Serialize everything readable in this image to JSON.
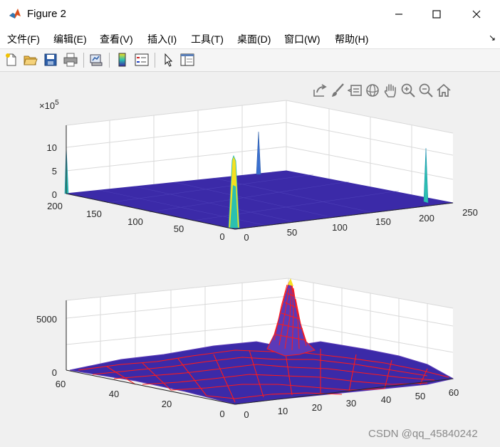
{
  "window": {
    "title": "Figure 2",
    "controls": [
      "minimize",
      "maximize",
      "close"
    ]
  },
  "menu": [
    {
      "label": "文件(F)"
    },
    {
      "label": "编辑(E)"
    },
    {
      "label": "查看(V)"
    },
    {
      "label": "插入(I)"
    },
    {
      "label": "工具(T)"
    },
    {
      "label": "桌面(D)"
    },
    {
      "label": "窗口(W)"
    },
    {
      "label": "帮助(H)"
    }
  ],
  "toolbar": [
    "new-figure-icon",
    "open-file-icon",
    "save-icon",
    "print-icon",
    "link-plot-icon",
    "colorbar-icon",
    "legend-icon",
    "edit-plot-arrow-icon",
    "property-inspector-icon"
  ],
  "axes_toolbar": [
    "export-icon",
    "brush-icon",
    "data-tips-icon",
    "rotate-3d-icon",
    "pan-hand-icon",
    "zoom-in-icon",
    "zoom-out-icon",
    "home-icon"
  ],
  "plot1": {
    "exponent_base": "×10",
    "exponent_power": "5",
    "z_ticks": [
      "0",
      "5",
      "10"
    ],
    "y_ticks": [
      "0",
      "50",
      "100",
      "150",
      "200"
    ],
    "x_ticks": [
      "0",
      "50",
      "100",
      "150",
      "200",
      "250"
    ]
  },
  "plot2": {
    "z_ticks": [
      "0",
      "5000"
    ],
    "y_ticks": [
      "0",
      "20",
      "40",
      "60"
    ],
    "x_ticks": [
      "0",
      "10",
      "20",
      "30",
      "40",
      "50",
      "60"
    ]
  },
  "watermark": "CSDN @qq_45840242"
}
